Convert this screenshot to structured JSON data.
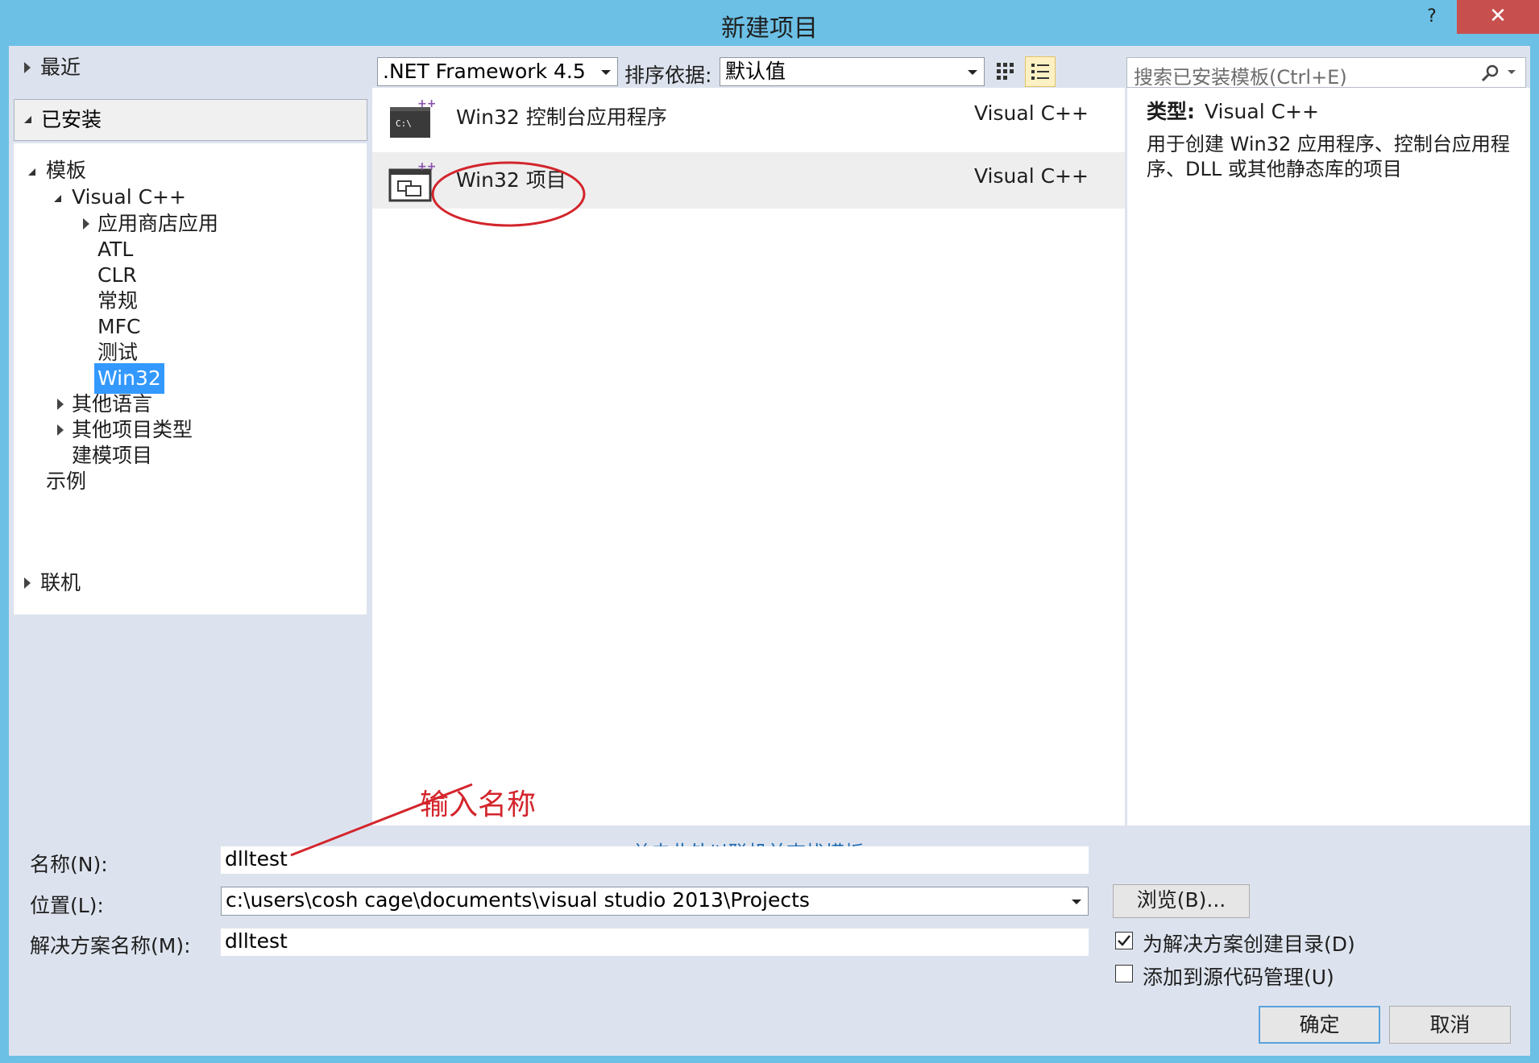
{
  "window": {
    "title": "新建项目",
    "help_label": "?",
    "close_label": "✕"
  },
  "tree": {
    "recent": "最近",
    "installed": "已安装",
    "templates": "模板",
    "visual_cpp": "Visual C++",
    "cpp_children": [
      "应用商店应用",
      "ATL",
      "CLR",
      "常规",
      "MFC",
      "测试",
      "Win32"
    ],
    "other_languages": "其他语言",
    "other_project_types": "其他项目类型",
    "modeling_projects": "建模项目",
    "samples": "示例",
    "online": "联机"
  },
  "toolbar": {
    "framework": ".NET Framework 4.5",
    "sort_label": "排序依据:",
    "sort_value": "默认值"
  },
  "search": {
    "placeholder": "搜索已安装模板(Ctrl+E)"
  },
  "templates": [
    {
      "name": "Win32 控制台应用程序",
      "lang": "Visual C++"
    },
    {
      "name": "Win32 项目",
      "lang": "Visual C++"
    }
  ],
  "online_link": "单击此处以联机并查找模板。",
  "description": {
    "type_label": "类型:",
    "type_value": "Visual C++",
    "text": "用于创建 Win32 应用程序、控制台应用程序、DLL 或其他静态库的项目"
  },
  "form": {
    "name_label": "名称(N):",
    "name_value": "dlltest",
    "location_label": "位置(L):",
    "location_value": "c:\\users\\cosh cage\\documents\\visual studio 2013\\Projects",
    "solution_label": "解决方案名称(M):",
    "solution_value": "dlltest",
    "browse": "浏览(B)...",
    "create_dir": "为解决方案创建目录(D)",
    "create_dir_checked": true,
    "add_source_control": "添加到源代码管理(U)",
    "add_source_control_checked": false,
    "ok": "确定",
    "cancel": "取消"
  },
  "annotation": {
    "text": "输入名称",
    "color": "#d3252c"
  },
  "colors": {
    "title_bar": "#6cc0e5",
    "selection": "#3399ff",
    "close": "#c7504f"
  }
}
